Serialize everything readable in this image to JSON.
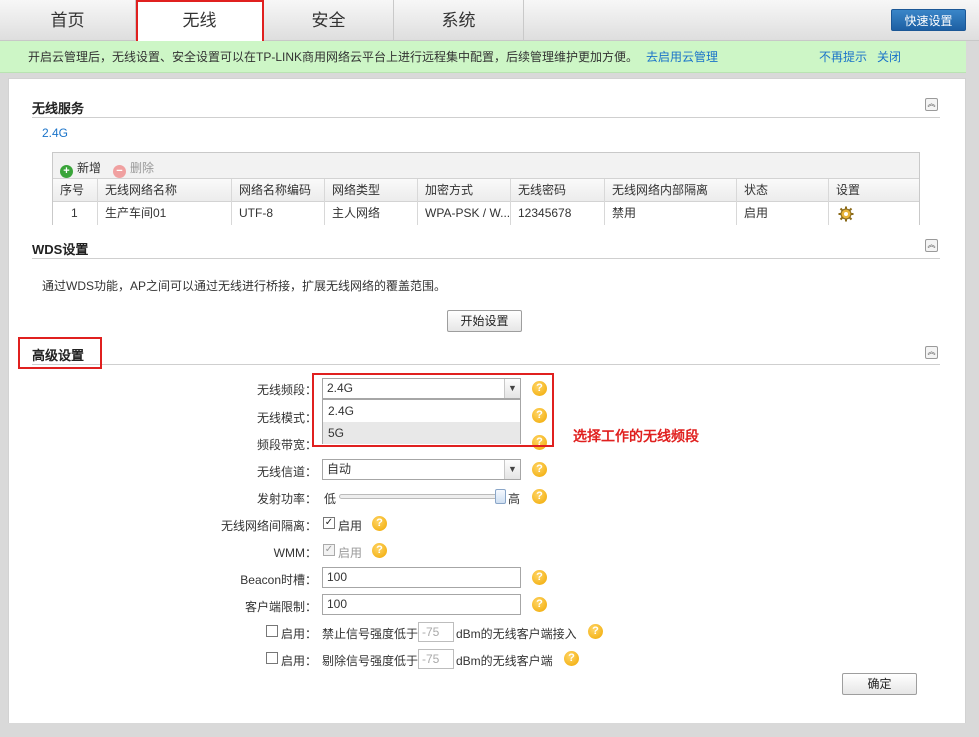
{
  "nav": {
    "tabs": [
      {
        "label": "首页"
      },
      {
        "label": "无线"
      },
      {
        "label": "安全"
      },
      {
        "label": "系统"
      }
    ],
    "quick_setup": "快速设置"
  },
  "banner": {
    "message": "开启云管理后，无线设置、安全设置可以在TP-LINK商用网络云平台上进行远程集中配置，后续管理维护更加方便。",
    "enable_link": "去启用云管理",
    "dont_remind": "不再提示",
    "close": "关闭"
  },
  "wireless_service": {
    "title": "无线服务",
    "band_label": "2.4G",
    "add": "新增",
    "delete": "删除",
    "columns": [
      "序号",
      "无线网络名称",
      "网络名称编码",
      "网络类型",
      "加密方式",
      "无线密码",
      "无线网络内部隔离",
      "状态",
      "设置"
    ],
    "rows": [
      [
        "1",
        "生产车间01",
        "UTF-8",
        "主人网络",
        "WPA-PSK / W...",
        "12345678",
        "禁用",
        "启用"
      ]
    ]
  },
  "wds": {
    "title": "WDS设置",
    "description": "通过WDS功能，AP之间可以通过无线进行桥接，扩展无线网络的覆盖范围。",
    "start_button": "开始设置"
  },
  "advanced": {
    "title": "高级设置",
    "band": {
      "label": "无线频段：",
      "value": "2.4G",
      "options": [
        "2.4G",
        "5G"
      ]
    },
    "mode": {
      "label": "无线模式："
    },
    "bandwidth": {
      "label": "频段带宽："
    },
    "channel": {
      "label": "无线信道：",
      "value": "自动"
    },
    "power": {
      "label": "发射功率：",
      "low": "低",
      "high": "高",
      "level_fraction": 1.0
    },
    "isolation": {
      "label": "无线网络间隔离：",
      "checkbox_label": "启用",
      "checked": true
    },
    "wmm": {
      "label": "WMM：",
      "checkbox_label": "启用",
      "checked": true,
      "disabled": true
    },
    "beacon": {
      "label": "Beacon时槽：",
      "value": "100"
    },
    "client_limit": {
      "label": "客户端限制：",
      "value": "100"
    },
    "reject_weak": {
      "checkbox_label": "启用：",
      "prefix": "禁止信号强度低于",
      "value": "-75",
      "suffix": "dBm的无线客户端接入"
    },
    "kick_weak": {
      "checkbox_label": "启用：",
      "prefix": "剔除信号强度低于",
      "value": "-75",
      "suffix": "dBm的无线客户端"
    },
    "confirm": "确定"
  },
  "annotation": {
    "text": "选择工作的无线频段",
    "color": "#e0201f"
  }
}
